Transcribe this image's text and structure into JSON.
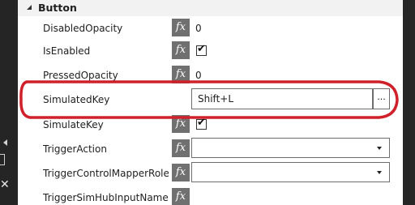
{
  "section": {
    "title": "Button"
  },
  "fx_label": "fx",
  "properties": [
    {
      "name": "DisabledOpacity",
      "value": "0"
    },
    {
      "name": "IsEnabled",
      "checked": true
    },
    {
      "name": "PressedOpacity",
      "value": "0"
    },
    {
      "name": "SimulatedKey",
      "value": "Shift+L",
      "button_label": "..."
    },
    {
      "name": "SimulateKey",
      "checked": true
    },
    {
      "name": "TriggerAction",
      "value": ""
    },
    {
      "name": "TriggerControlMapperRole..",
      "value": ""
    },
    {
      "name": "TriggerSimHubInputName"
    }
  ],
  "checkmark_glyph": "✔",
  "side_panel": {
    "close_glyph": "✕"
  },
  "colors": {
    "highlight_ellipse": "#d0202a",
    "fx_button": "#707070",
    "dark_chrome": "#252525"
  }
}
